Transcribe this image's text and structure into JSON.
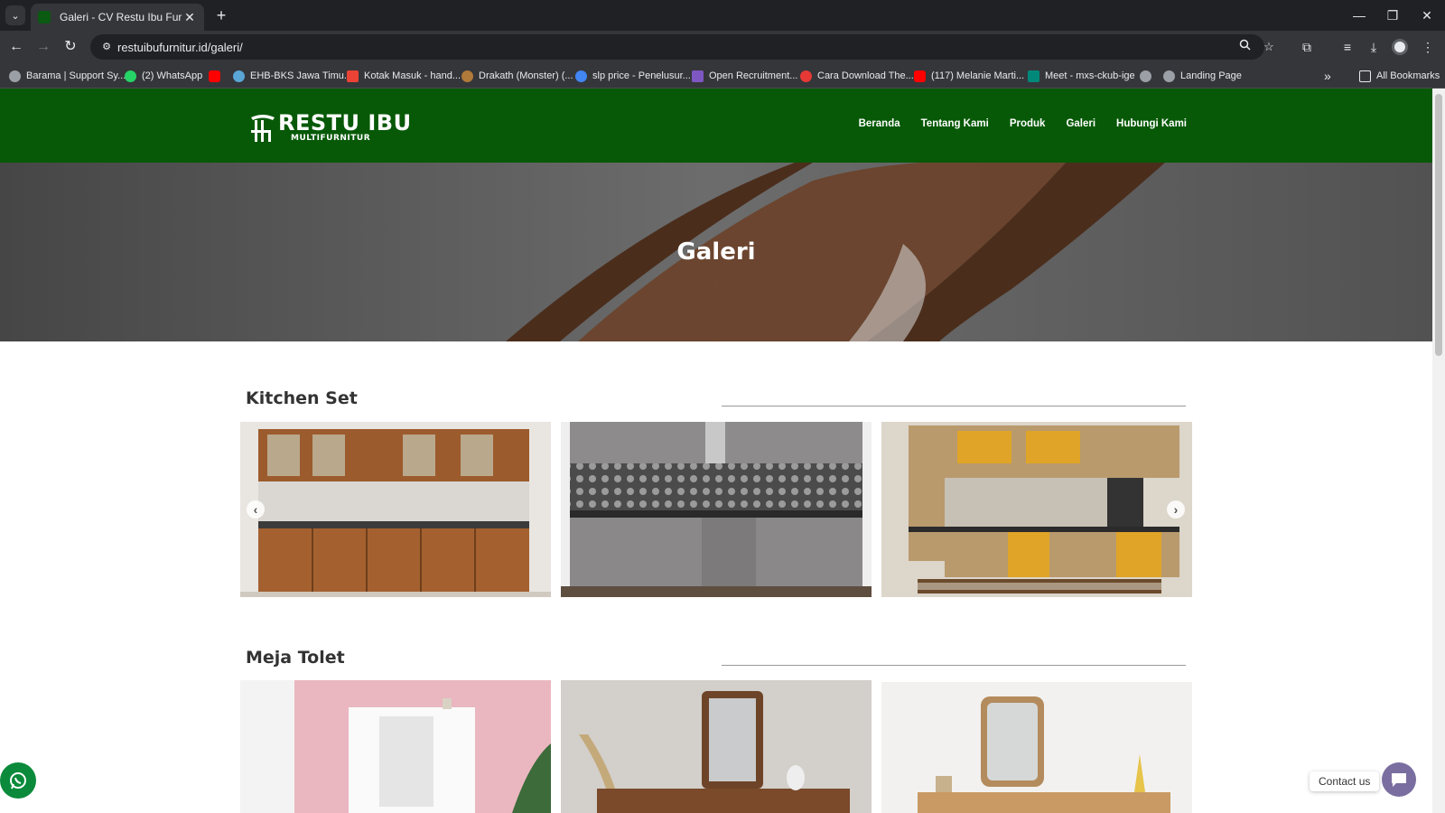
{
  "browser": {
    "tab_title": "Galeri - CV Restu Ibu Furniture",
    "tab_close": "✕",
    "new_tab": "+",
    "dropdown": "⌄",
    "window_controls": [
      "—",
      "❐",
      "✕"
    ],
    "nav_back": "←",
    "nav_forward": "→",
    "reload": "↻",
    "site_info": "⚙",
    "url": "restuibufurnitur.id/galeri/",
    "bookmarks": [
      {
        "label": "Barama | Support Sy...",
        "icon": "globe-icon",
        "color": "#9aa0a6"
      },
      {
        "label": "(2) WhatsApp",
        "icon": "whatsapp-icon",
        "color": "#25d366"
      },
      {
        "label": "",
        "icon": "youtube-icon",
        "color": "#ff0000"
      },
      {
        "label": "EHB-BKS Jawa Timu...",
        "icon": "globe-icon",
        "color": "#5aa6d6"
      },
      {
        "label": "Kotak Masuk - hand...",
        "icon": "gmail-icon",
        "color": "#ea4335"
      },
      {
        "label": "Drakath (Monster) (...",
        "icon": "game-icon",
        "color": "#b07a3a"
      },
      {
        "label": "slp price - Penelusur...",
        "icon": "google-icon",
        "color": "#4285f4"
      },
      {
        "label": "Open Recruitment...",
        "icon": "forms-icon",
        "color": "#7e57c2"
      },
      {
        "label": "Cara Download The...",
        "icon": "bookmark-s-icon",
        "color": "#e53935"
      },
      {
        "label": "(117) Melanie Marti...",
        "icon": "youtube-icon",
        "color": "#ff0000"
      },
      {
        "label": "Meet - mxs-ckub-ige",
        "icon": "meet-icon",
        "color": "#00897b"
      },
      {
        "label": "",
        "icon": "globe-icon",
        "color": "#9aa0a6"
      },
      {
        "label": "Landing Page",
        "icon": "globe-icon",
        "color": "#9aa0a6"
      }
    ],
    "more_bookmarks": "»",
    "all_bookmarks": "All Bookmarks"
  },
  "site": {
    "logo_main": "RESTU IBU",
    "logo_sub": "MULTIFURNITUR",
    "nav": [
      "Beranda",
      "Tentang Kami",
      "Produk",
      "Galeri",
      "Hubungi Kami"
    ],
    "hero_title": "Galeri",
    "sections": [
      {
        "title": "Kitchen Set"
      },
      {
        "title": "Meja Tolet"
      }
    ],
    "carousel_prev": "‹",
    "carousel_next": "›",
    "contact_label": "Contact us"
  },
  "colors": {
    "header_bg": "#075907",
    "tab_bg": "#35363a",
    "chrome_bg": "#202124"
  }
}
